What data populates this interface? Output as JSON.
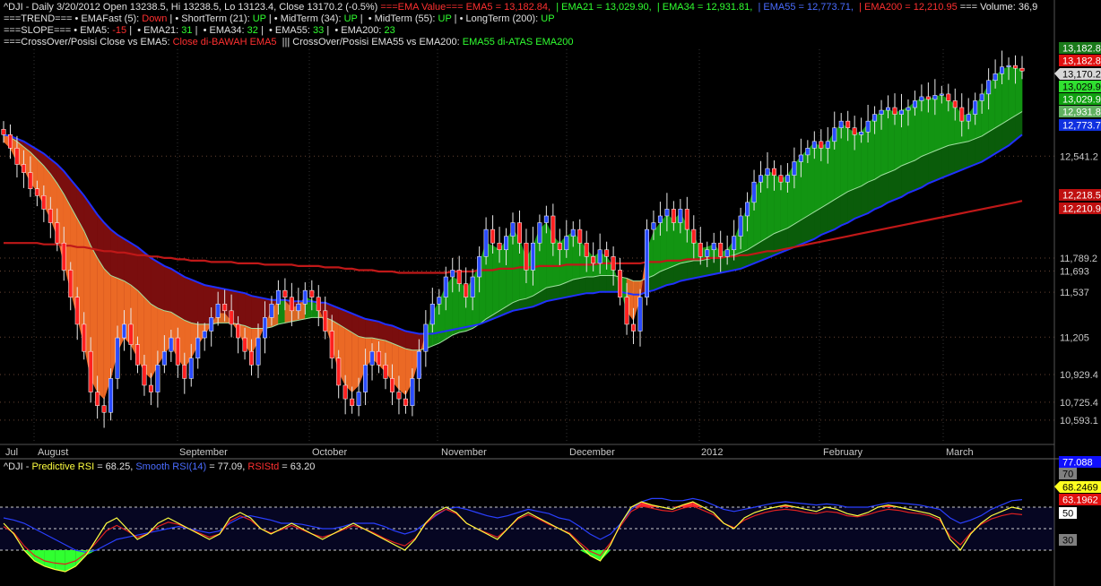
{
  "header": {
    "line1_prefix": "^DJI - Daily 3/20/2012 Open 13238.5, Hi 13238.5, Lo 13123.4, Close 13170.2 (-0.5%)",
    "line1_ema_label": " ===EMA Value=== EMA5 = 13,182.84,  ",
    "line1_ema21": "| EMA21 = 13,029.90,  ",
    "line1_ema34": "| EMA34 = 12,931.81,  ",
    "line1_ema55": "| EMA55 = 12,773.71,  ",
    "line1_ema200": "| EMA200 = 12,210.95",
    "line1_volume": " === Volume: 36,9",
    "line2_label": "===TREND=== • EMAFast (5): ",
    "line2_fast": "Down",
    "line2_short_label": " | • ShortTerm (21): ",
    "line2_short": "UP",
    "line2_mid_label": " | • MidTerm (34): ",
    "line2_mid": "UP",
    "line2_mid55_label": " |  • MidTerm (55): ",
    "line2_mid55": "UP",
    "line2_long_label": " | • LongTerm (200): ",
    "line2_long": "UP",
    "line3_label": "===SLOPE=== • EMA5: ",
    "line3_ema5": "-15",
    "line3_ema21_label": " |  • EMA21: ",
    "line3_ema21": "31",
    "line3_ema34_label": " |  • EMA34: ",
    "line3_ema34": "32",
    "line3_ema55_label": " |  • EMA55: ",
    "line3_ema55": "33",
    "line3_ema200_label": " |  • EMA200: ",
    "line3_ema200": "23",
    "line4_label": "===CrossOver/Posisi Close vs EMA5: ",
    "line4_close": "Close di-BAWAH EMA5",
    "line4_mid": "  ||| CrossOver/Posisi EMA55 vs EMA200: ",
    "line4_ema": "EMA55 di-ATAS EMA200"
  },
  "axis": {
    "x_labels": [
      "Jul",
      "August",
      "September",
      "October",
      "November",
      "December",
      "2012",
      "February",
      "March"
    ],
    "price_ticks": [
      "12,541.2",
      "11,789.2",
      "11,693",
      "11,537",
      "11,205",
      "10,929.4",
      "10,725.4",
      "10,593.1"
    ],
    "price_badges": [
      {
        "text": "13,182.8",
        "bg": "#1a7a1a",
        "fg": "#ffffff"
      },
      {
        "text": "13,182.8",
        "bg": "#e01010",
        "fg": "#ffffff"
      },
      {
        "text": "13,170.2",
        "bg": "#d8d8d8",
        "fg": "#000000"
      },
      {
        "text": "13,029.9",
        "bg": "#30e030",
        "fg": "#000000"
      },
      {
        "text": "13,029.9",
        "bg": "#10a010",
        "fg": "#ffffff"
      },
      {
        "text": "12,931.8",
        "bg": "#60b060",
        "fg": "#ffffff"
      },
      {
        "text": "12,773.7",
        "bg": "#1030e0",
        "fg": "#ffffff"
      },
      {
        "text": "12,218.5",
        "bg": "#c01010",
        "fg": "#ffffff"
      },
      {
        "text": "12,210.9",
        "bg": "#c01010",
        "fg": "#ffffff"
      }
    ]
  },
  "rsi": {
    "title": "^DJI - ",
    "pred_label": "Predictive RSI",
    "pred_value": " = 68.25, ",
    "smooth_label": "Smooth RSI(14)",
    "smooth_value": " = 77.09, ",
    "std_label": "RSIStd",
    "std_value": " = 63.20",
    "badges": [
      {
        "text": "77.088",
        "bg": "#1010ff",
        "fg": "#ffffff"
      },
      {
        "text": "70",
        "bg": "#808080",
        "fg": "#000000"
      },
      {
        "text": "68.2469",
        "bg": "#ffff20",
        "fg": "#000000"
      },
      {
        "text": "63.1962",
        "bg": "#e01010",
        "fg": "#ffffff"
      },
      {
        "text": "50",
        "bg": "#ffffff",
        "fg": "#000000"
      },
      {
        "text": "30",
        "bg": "#808080",
        "fg": "#000000"
      }
    ]
  },
  "colors": {
    "up_candle": "#2a4cff",
    "down_candle": "#ff2020",
    "ema200": "#c01818",
    "ema55": "#2030ff",
    "bull_band": "#0a6a0a",
    "bear_band": "#8a1010"
  },
  "chart_data": {
    "type": "candlestick",
    "ylim": [
      10420,
      13330
    ],
    "close": [
      12700,
      12600,
      12480,
      12420,
      12300,
      12250,
      12150,
      12050,
      11900,
      11700,
      11500,
      11300,
      11100,
      10800,
      10700,
      10650,
      10900,
      11200,
      11300,
      11150,
      11000,
      10850,
      10800,
      11000,
      11100,
      11200,
      11000,
      10900,
      11050,
      11200,
      11250,
      11350,
      11450,
      11400,
      11300,
      11200,
      11100,
      11000,
      11200,
      11350,
      11450,
      11550,
      11500,
      11400,
      11450,
      11550,
      11500,
      11400,
      11250,
      11050,
      10850,
      10750,
      10700,
      10800,
      11000,
      11100,
      11000,
      10900,
      10800,
      10750,
      10700,
      10900,
      11100,
      11300,
      11450,
      11500,
      11650,
      11700,
      11600,
      11500,
      11650,
      11800,
      12000,
      11900,
      11850,
      11950,
      12050,
      11900,
      11700,
      11900,
      12050,
      12100,
      11900,
      11850,
      11950,
      12000,
      11900,
      11800,
      11750,
      11850,
      11800,
      11700,
      11500,
      11300,
      11250,
      11500,
      12000,
      12050,
      12100,
      12150,
      12050,
      12150,
      12000,
      11900,
      11800,
      11850,
      11900,
      11800,
      11850,
      11950,
      12100,
      12200,
      12350,
      12400,
      12450,
      12400,
      12350,
      12400,
      12500,
      12550,
      12600,
      12650,
      12600,
      12650,
      12750,
      12800,
      12750,
      12700,
      12720,
      12800,
      12850,
      12880,
      12900,
      12850,
      12880,
      12900,
      12950,
      12980,
      12960,
      12990,
      13000,
      12950,
      12900,
      12800,
      12850,
      12950,
      13000,
      13100,
      13150,
      13200,
      13210,
      13190,
      13170
    ],
    "ema5": [
      12650,
      12600,
      12500,
      12450,
      12350,
      12280,
      12180,
      12080,
      11950,
      11750,
      11550,
      11350,
      11150,
      10900,
      10800,
      10750,
      10900,
      11100,
      11200,
      11150,
      11050,
      10950,
      10900,
      11000,
      11080,
      11150,
      11050,
      10980,
      11050,
      11150,
      11220,
      11300,
      11380,
      11380,
      11320,
      11250,
      11150,
      11080,
      11180,
      11300,
      11400,
      11480,
      11470,
      11420,
      11440,
      11500,
      11480,
      11420,
      11300,
      11150,
      10950,
      10850,
      10800,
      10850,
      10980,
      11050,
      11000,
      10950,
      10880,
      10820,
      10780,
      10880,
      11050,
      11230,
      11380,
      11470,
      11580,
      11650,
      11620,
      11560,
      11630,
      11750,
      11900,
      11880,
      11850,
      11920,
      12000,
      11930,
      11780,
      11880,
      12000,
      12050,
      11950,
      11900,
      11950,
      11980,
      11920,
      11850,
      11800,
      11830,
      11800,
      11720,
      11570,
      11400,
      11330,
      11500,
      11850,
      11980,
      12050,
      12110,
      12070,
      12120,
      12030,
      11950,
      11860,
      11870,
      11890,
      11830,
      11850,
      11920,
      12050,
      12160,
      12300,
      12370,
      12430,
      12410,
      12370,
      12400,
      12480,
      12540,
      12590,
      12640,
      12610,
      12640,
      12720,
      12780,
      12750,
      12710,
      12720,
      12780,
      12830,
      12870,
      12890,
      12860,
      12880,
      12900,
      12940,
      12970,
      12960,
      12980,
      12990,
      12960,
      12920,
      12840,
      12850,
      12920,
      12980,
      13070,
      13130,
      13180,
      13200,
      13190,
      13183
    ],
    "ema34": [
      12700,
      12680,
      12650,
      12610,
      12570,
      12520,
      12470,
      12410,
      12340,
      12260,
      12170,
      12080,
      11990,
      11880,
      11790,
      11710,
      11660,
      11640,
      11620,
      11590,
      11550,
      11500,
      11450,
      11420,
      11400,
      11390,
      11360,
      11330,
      11310,
      11300,
      11300,
      11300,
      11310,
      11310,
      11310,
      11300,
      11290,
      11270,
      11270,
      11270,
      11280,
      11300,
      11310,
      11320,
      11330,
      11340,
      11350,
      11350,
      11350,
      11330,
      11300,
      11270,
      11240,
      11210,
      11200,
      11200,
      11190,
      11180,
      11160,
      11140,
      11120,
      11110,
      11110,
      11120,
      11140,
      11160,
      11190,
      11220,
      11240,
      11250,
      11270,
      11300,
      11340,
      11370,
      11400,
      11430,
      11460,
      11480,
      11490,
      11510,
      11540,
      11570,
      11580,
      11590,
      11610,
      11630,
      11640,
      11650,
      11650,
      11660,
      11660,
      11660,
      11650,
      11640,
      11620,
      11620,
      11640,
      11660,
      11690,
      11710,
      11730,
      11750,
      11760,
      11770,
      11770,
      11780,
      11790,
      11790,
      11800,
      11810,
      11830,
      11850,
      11880,
      11910,
      11940,
      11970,
      11990,
      12010,
      12040,
      12070,
      12100,
      12130,
      12160,
      12190,
      12220,
      12250,
      12280,
      12300,
      12320,
      12350,
      12370,
      12400,
      12420,
      12440,
      12470,
      12490,
      12510,
      12540,
      12560,
      12580,
      12600,
      12620,
      12630,
      12640,
      12650,
      12670,
      12690,
      12720,
      12750,
      12780,
      12810,
      12840,
      12870
    ],
    "ema55": [
      12700,
      12690,
      12670,
      12650,
      12620,
      12590,
      12560,
      12520,
      12480,
      12430,
      12370,
      12310,
      12250,
      12180,
      12110,
      12050,
      12000,
      11960,
      11930,
      11900,
      11870,
      11830,
      11790,
      11760,
      11730,
      11710,
      11680,
      11650,
      11630,
      11610,
      11590,
      11580,
      11570,
      11560,
      11550,
      11540,
      11530,
      11510,
      11500,
      11490,
      11480,
      11480,
      11480,
      11470,
      11470,
      11470,
      11470,
      11460,
      11460,
      11440,
      11420,
      11400,
      11380,
      11360,
      11340,
      11330,
      11320,
      11300,
      11290,
      11270,
      11250,
      11240,
      11230,
      11230,
      11230,
      11240,
      11250,
      11260,
      11270,
      11280,
      11290,
      11300,
      11320,
      11340,
      11360,
      11380,
      11400,
      11410,
      11420,
      11430,
      11450,
      11470,
      11480,
      11490,
      11500,
      11510,
      11520,
      11530,
      11530,
      11540,
      11540,
      11540,
      11540,
      11530,
      11520,
      11520,
      11540,
      11550,
      11570,
      11590,
      11600,
      11620,
      11630,
      11640,
      11650,
      11660,
      11670,
      11680,
      11690,
      11700,
      11710,
      11730,
      11750,
      11770,
      11790,
      11810,
      11830,
      11850,
      11870,
      11890,
      11910,
      11930,
      11960,
      11980,
      12000,
      12030,
      12050,
      12080,
      12100,
      12120,
      12150,
      12170,
      12200,
      12220,
      12240,
      12270,
      12290,
      12310,
      12340,
      12360,
      12380,
      12400,
      12420,
      12440,
      12460,
      12480,
      12500,
      12530,
      12560,
      12590,
      12620,
      12660,
      12700
    ],
    "ema200": [
      11900,
      11900,
      11900,
      11900,
      11900,
      11900,
      11890,
      11890,
      11890,
      11880,
      11880,
      11870,
      11870,
      11860,
      11850,
      11840,
      11840,
      11830,
      11830,
      11820,
      11810,
      11810,
      11800,
      11800,
      11790,
      11790,
      11780,
      11780,
      11770,
      11770,
      11770,
      11760,
      11760,
      11760,
      11760,
      11750,
      11750,
      11750,
      11750,
      11740,
      11740,
      11740,
      11740,
      11740,
      11730,
      11730,
      11730,
      11730,
      11720,
      11720,
      11720,
      11710,
      11710,
      11700,
      11700,
      11700,
      11690,
      11690,
      11690,
      11680,
      11680,
      11680,
      11680,
      11680,
      11680,
      11680,
      11680,
      11690,
      11690,
      11690,
      11690,
      11700,
      11700,
      11700,
      11710,
      11710,
      11710,
      11720,
      11720,
      11720,
      11730,
      11730,
      11730,
      11730,
      11740,
      11740,
      11740,
      11740,
      11740,
      11750,
      11750,
      11750,
      11750,
      11750,
      11750,
      11750,
      11760,
      11760,
      11760,
      11770,
      11770,
      11770,
      11780,
      11780,
      11780,
      11790,
      11790,
      11790,
      11800,
      11800,
      11810,
      11810,
      11820,
      11830,
      11840,
      11840,
      11850,
      11860,
      11870,
      11880,
      11890,
      11900,
      11910,
      11920,
      11930,
      11940,
      11950,
      11960,
      11970,
      11980,
      11990,
      12000,
      12010,
      12020,
      12030,
      12040,
      12050,
      12060,
      12070,
      12080,
      12090,
      12100,
      12110,
      12120,
      12130,
      12140,
      12150,
      12160,
      12170,
      12180,
      12190,
      12200,
      12211
    ],
    "rsi": {
      "ylim": [
        0,
        100
      ],
      "pred": [
        55,
        45,
        30,
        20,
        15,
        12,
        10,
        15,
        25,
        40,
        55,
        60,
        50,
        40,
        45,
        55,
        60,
        55,
        50,
        45,
        40,
        45,
        60,
        65,
        60,
        50,
        45,
        50,
        55,
        50,
        45,
        40,
        45,
        50,
        55,
        50,
        45,
        40,
        35,
        30,
        40,
        55,
        65,
        70,
        65,
        55,
        50,
        45,
        40,
        50,
        60,
        65,
        60,
        55,
        50,
        45,
        35,
        25,
        20,
        35,
        55,
        70,
        75,
        72,
        70,
        68,
        72,
        75,
        70,
        65,
        55,
        50,
        60,
        65,
        68,
        70,
        72,
        70,
        68,
        66,
        70,
        68,
        64,
        62,
        65,
        70,
        72,
        70,
        68,
        66,
        64,
        60,
        40,
        30,
        45,
        55,
        62,
        66,
        70,
        68
      ],
      "smooth": [
        60,
        58,
        55,
        50,
        45,
        40,
        35,
        30,
        28,
        30,
        35,
        40,
        42,
        44,
        46,
        48,
        50,
        52,
        50,
        48,
        46,
        48,
        55,
        60,
        62,
        60,
        58,
        55,
        55,
        54,
        52,
        50,
        50,
        52,
        55,
        55,
        55,
        52,
        48,
        45,
        48,
        55,
        62,
        68,
        70,
        68,
        65,
        62,
        60,
        62,
        65,
        68,
        66,
        64,
        60,
        58,
        52,
        45,
        40,
        45,
        55,
        68,
        75,
        78,
        78,
        76,
        76,
        78,
        76,
        72,
        68,
        66,
        68,
        70,
        72,
        74,
        75,
        74,
        73,
        72,
        73,
        72,
        70,
        70,
        70,
        72,
        74,
        74,
        73,
        72,
        70,
        68,
        60,
        55,
        58,
        62,
        68,
        72,
        76,
        77
      ],
      "std": [
        52,
        46,
        34,
        25,
        20,
        18,
        17,
        20,
        27,
        37,
        48,
        53,
        48,
        42,
        45,
        52,
        56,
        54,
        50,
        46,
        42,
        45,
        57,
        62,
        58,
        50,
        46,
        49,
        53,
        49,
        45,
        42,
        45,
        49,
        53,
        50,
        46,
        41,
        37,
        34,
        41,
        54,
        63,
        68,
        64,
        55,
        50,
        46,
        42,
        50,
        59,
        63,
        59,
        54,
        50,
        46,
        37,
        29,
        25,
        37,
        53,
        66,
        71,
        69,
        67,
        66,
        69,
        71,
        67,
        63,
        55,
        51,
        58,
        62,
        65,
        67,
        68,
        67,
        65,
        64,
        66,
        65,
        62,
        61,
        63,
        66,
        68,
        67,
        65,
        64,
        62,
        58,
        43,
        35,
        46,
        54,
        59,
        62,
        64,
        63
      ]
    }
  }
}
